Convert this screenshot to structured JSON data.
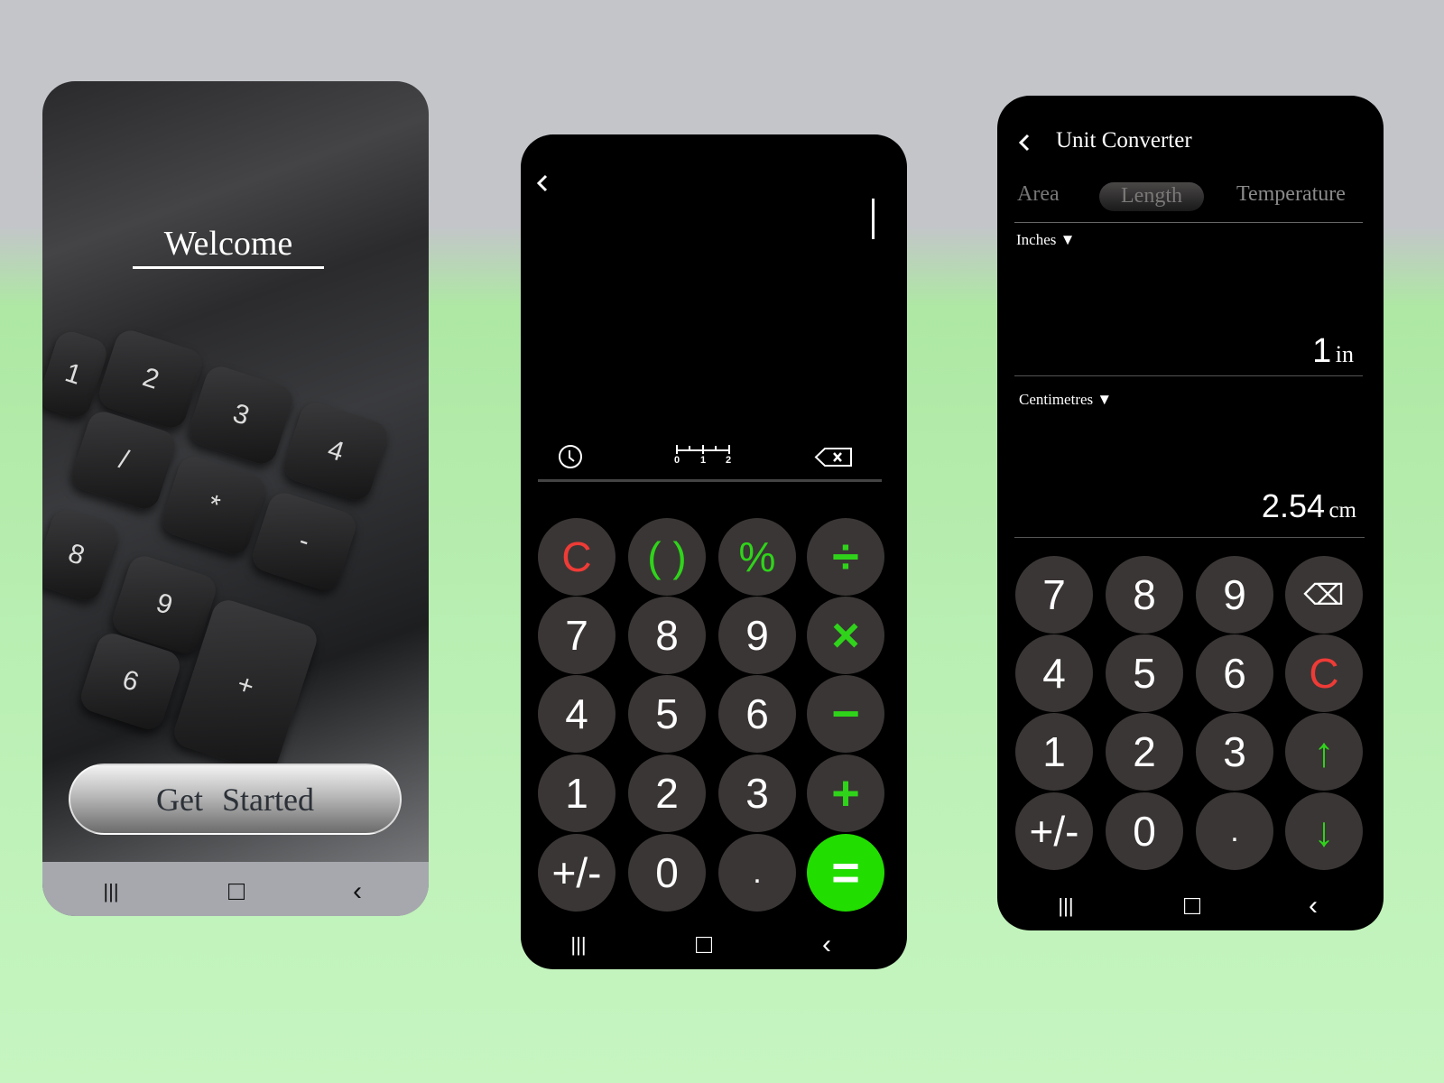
{
  "welcome_screen": {
    "title": "Welcome",
    "get_started_label": "Get Started",
    "photo_keys": [
      "1",
      "2",
      "3",
      "4",
      "/",
      "*",
      "-",
      "8",
      "9",
      "6",
      "+"
    ]
  },
  "calculator": {
    "history_icon": "clock-icon",
    "units_icon": "ruler-icon",
    "backspace_icon": "backspace-icon",
    "ruler_labels": [
      "0",
      "1",
      "2"
    ],
    "keys": [
      {
        "label": "C",
        "style": "red",
        "name": "clear"
      },
      {
        "label": "( )",
        "style": "green",
        "name": "parentheses"
      },
      {
        "label": "%",
        "style": "green",
        "name": "percent"
      },
      {
        "label": "÷",
        "style": "green",
        "name": "divide"
      },
      {
        "label": "7",
        "style": "",
        "name": "7"
      },
      {
        "label": "8",
        "style": "",
        "name": "8"
      },
      {
        "label": "9",
        "style": "",
        "name": "9"
      },
      {
        "label": "×",
        "style": "green",
        "name": "multiply"
      },
      {
        "label": "4",
        "style": "",
        "name": "4"
      },
      {
        "label": "5",
        "style": "",
        "name": "5"
      },
      {
        "label": "6",
        "style": "",
        "name": "6"
      },
      {
        "label": "−",
        "style": "green",
        "name": "minus"
      },
      {
        "label": "1",
        "style": "",
        "name": "1"
      },
      {
        "label": "2",
        "style": "",
        "name": "2"
      },
      {
        "label": "3",
        "style": "",
        "name": "3"
      },
      {
        "label": "+",
        "style": "green",
        "name": "plus"
      },
      {
        "label": "+/-",
        "style": "",
        "name": "negate"
      },
      {
        "label": "0",
        "style": "",
        "name": "0"
      },
      {
        "label": ".",
        "style": "",
        "name": "decimal"
      },
      {
        "label": "=",
        "style": "eq",
        "name": "equals"
      }
    ]
  },
  "converter": {
    "title": "Unit Converter",
    "tabs": [
      {
        "label": "Area",
        "active": false
      },
      {
        "label": "Length",
        "active": true
      },
      {
        "label": "Temperature",
        "active": false
      }
    ],
    "from_unit": "Inches",
    "from_value": "1",
    "from_suffix": "in",
    "to_unit": "Centimetres",
    "to_value": "2.54",
    "to_suffix": "cm",
    "keys": [
      {
        "label": "7",
        "style": "",
        "name": "7"
      },
      {
        "label": "8",
        "style": "",
        "name": "8"
      },
      {
        "label": "9",
        "style": "",
        "name": "9"
      },
      {
        "label": "⌫",
        "style": "",
        "name": "backspace"
      },
      {
        "label": "4",
        "style": "",
        "name": "4"
      },
      {
        "label": "5",
        "style": "",
        "name": "5"
      },
      {
        "label": "6",
        "style": "",
        "name": "6"
      },
      {
        "label": "C",
        "style": "red",
        "name": "clear"
      },
      {
        "label": "1",
        "style": "",
        "name": "1"
      },
      {
        "label": "2",
        "style": "",
        "name": "2"
      },
      {
        "label": "3",
        "style": "",
        "name": "3"
      },
      {
        "label": "↑",
        "style": "green",
        "name": "swap-up"
      },
      {
        "label": "+/-",
        "style": "",
        "name": "negate"
      },
      {
        "label": "0",
        "style": "",
        "name": "0"
      },
      {
        "label": ".",
        "style": "",
        "name": "decimal"
      },
      {
        "label": "↓",
        "style": "green",
        "name": "swap-down"
      }
    ]
  },
  "nav_bar": {
    "recents": "|||",
    "home": "□",
    "back": "‹"
  },
  "colors": {
    "accent_green": "#22dd00",
    "clear_red": "#ef3b36",
    "key_bg": "#3a3635"
  }
}
